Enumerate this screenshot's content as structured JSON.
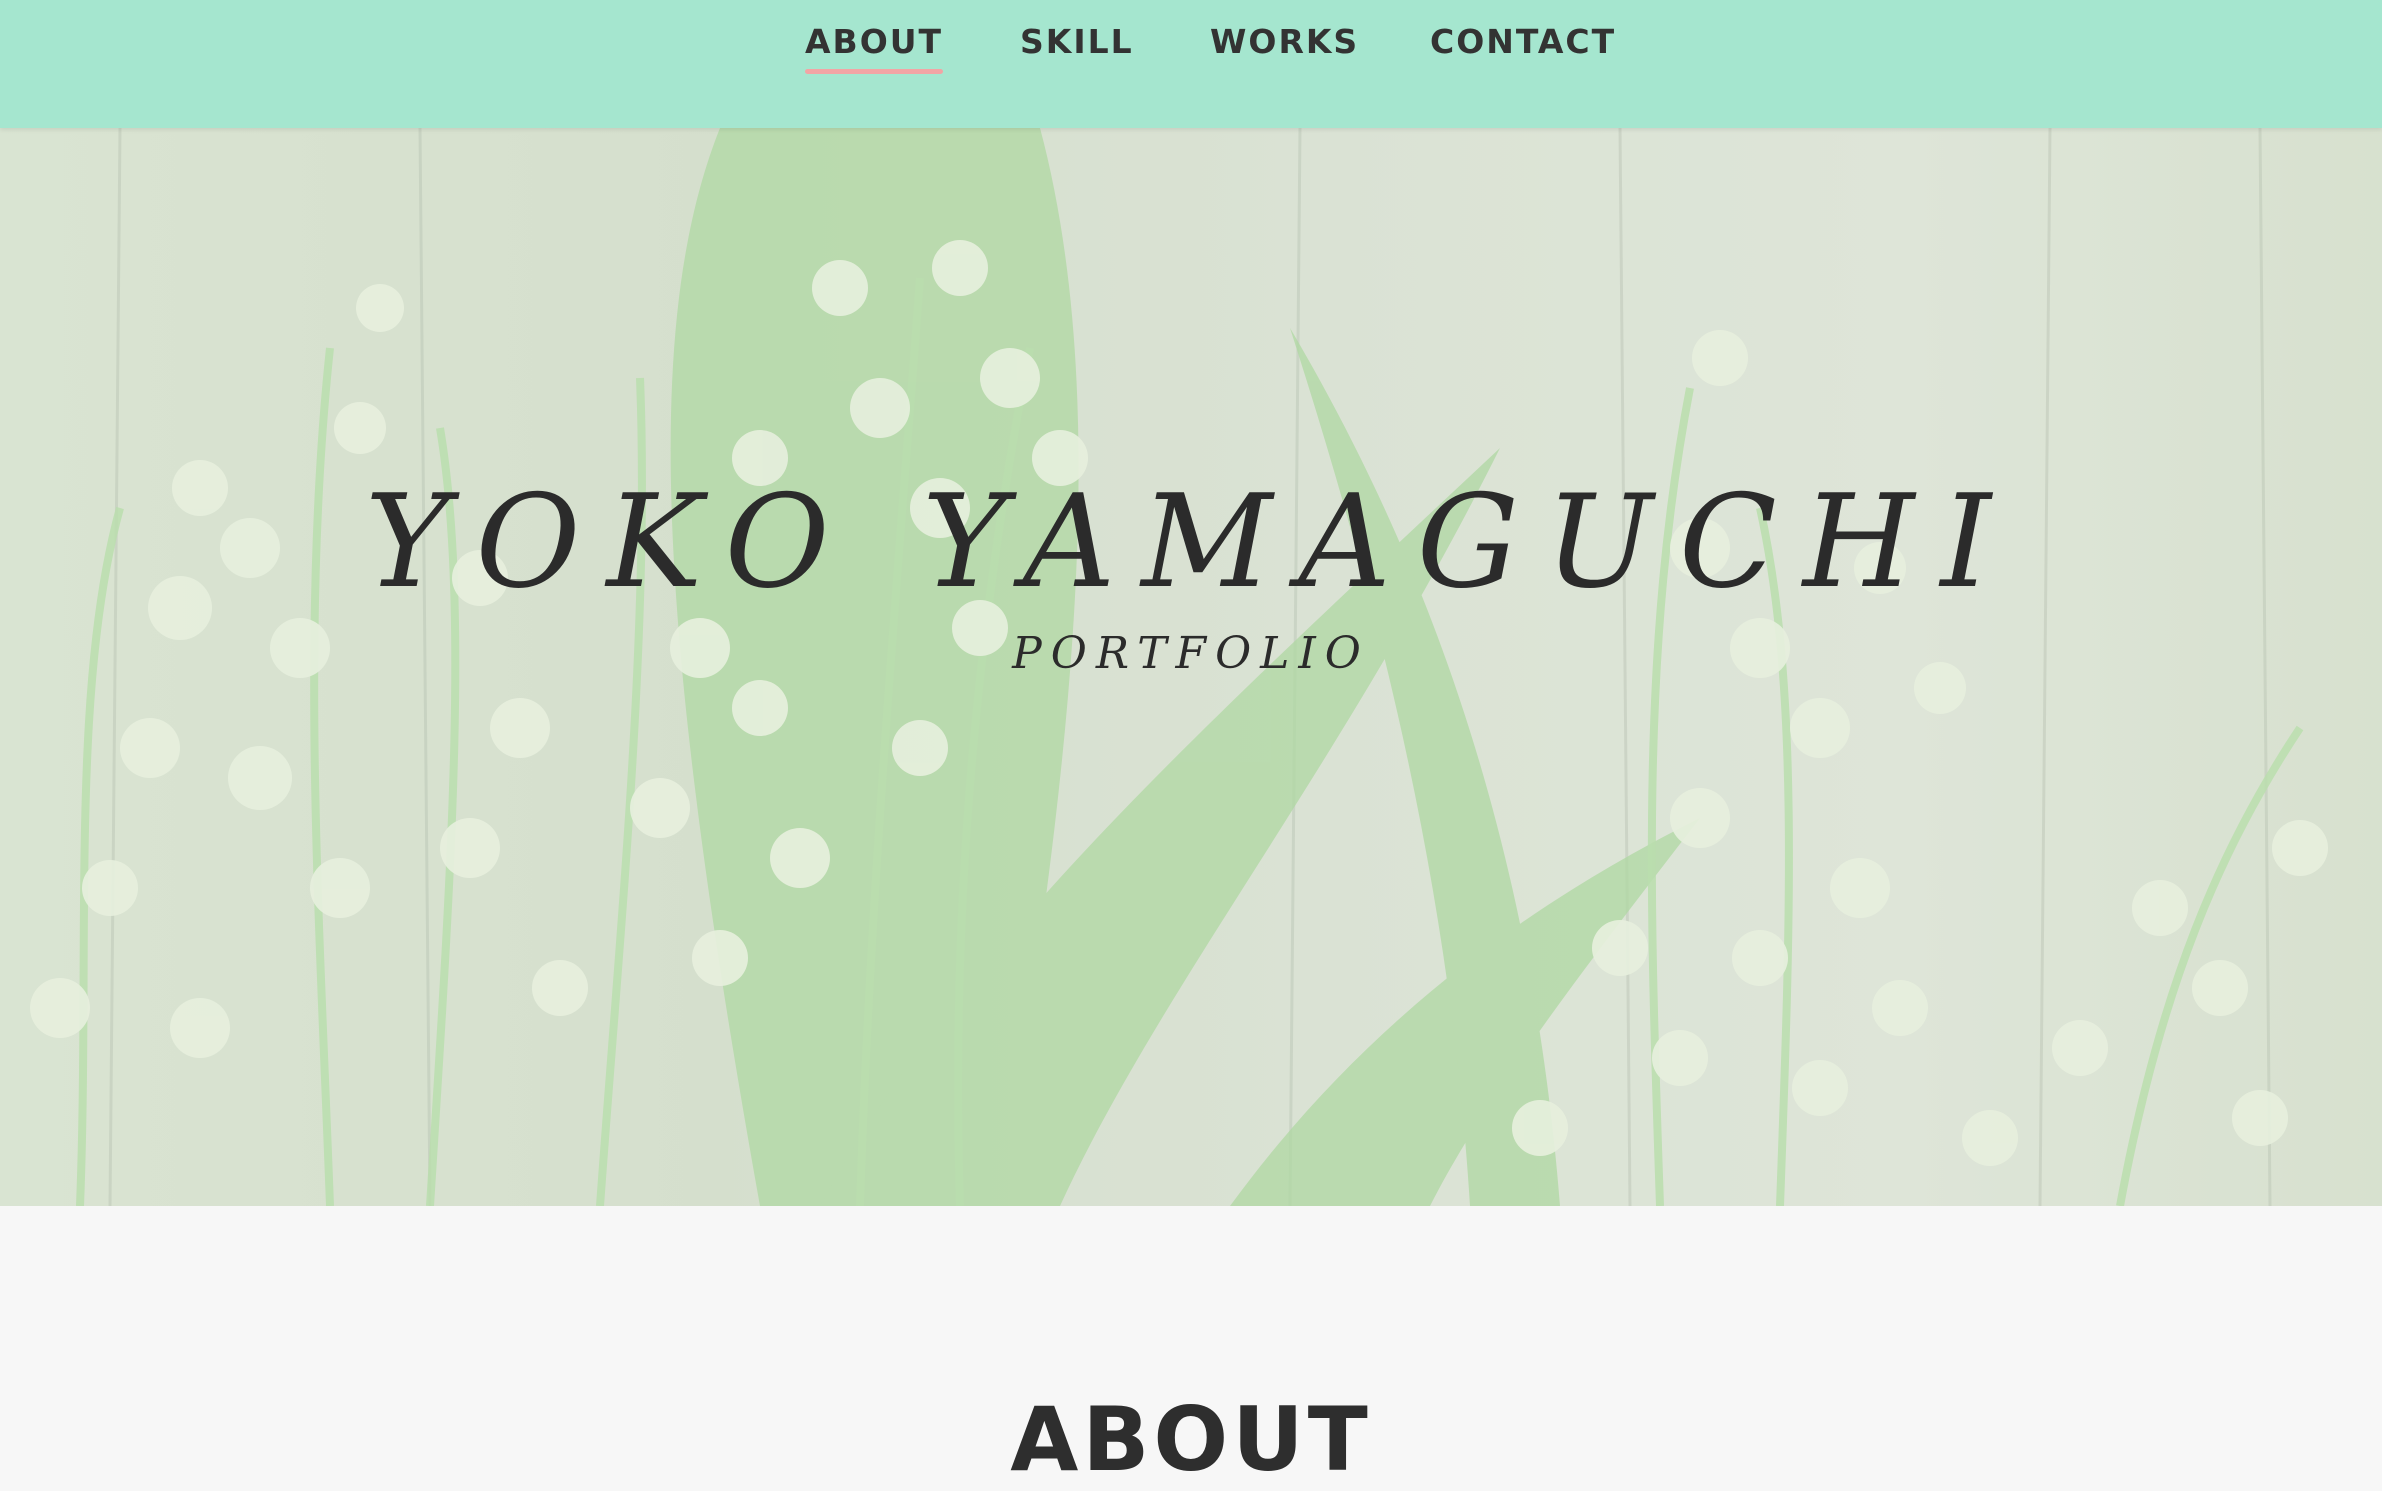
{
  "nav": {
    "items": [
      {
        "label": "ABOUT",
        "active": true
      },
      {
        "label": "SKILL",
        "active": false
      },
      {
        "label": "WORKS",
        "active": false
      },
      {
        "label": "CONTACT",
        "active": false
      }
    ]
  },
  "hero": {
    "title": "YOKO YAMAGUCHI",
    "subtitle": "PORTFOLIO"
  },
  "about": {
    "heading": "ABOUT"
  },
  "colors": {
    "nav_background": "#a5e6cf",
    "active_underline": "#f2a5a5",
    "text": "#333333",
    "page_background": "#f7f7f7"
  }
}
